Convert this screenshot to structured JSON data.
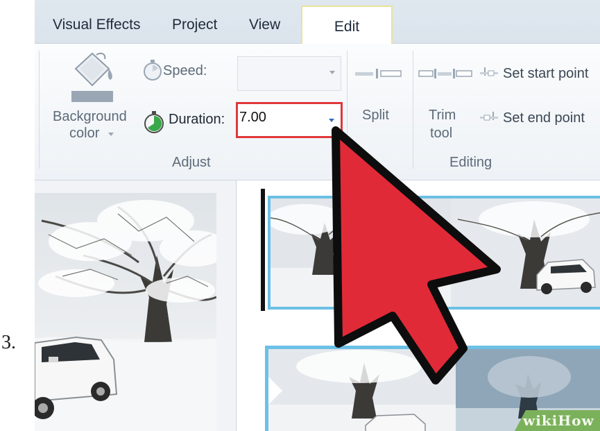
{
  "step": {
    "number": "3."
  },
  "tabs": [
    {
      "label": "Visual Effects"
    },
    {
      "label": "Project"
    },
    {
      "label": "View"
    },
    {
      "label": "Edit",
      "active": true
    }
  ],
  "ribbon": {
    "adjust": {
      "background_color_label_line1": "Background",
      "background_color_label_line2": "color",
      "speed_label": "Speed:",
      "speed_value": "",
      "duration_label": "Duration:",
      "duration_value": "7.00",
      "group_label": "Adjust"
    },
    "editing": {
      "split_label": "Split",
      "trim_label_line1": "Trim",
      "trim_label_line2": "tool",
      "set_start_label": "Set start point",
      "set_end_label": "Set end point",
      "group_label": "Editing"
    }
  },
  "watermark": {
    "text": "wikiHow"
  },
  "colors": {
    "highlight": "#e0373a",
    "cursor_fill": "#e12a38",
    "clip_border": "#6cc0e5",
    "tab_active_border": "#e9e39a",
    "watermark_bg": "#7bb15a"
  },
  "icons": [
    "paint-bucket-icon",
    "stopwatch-icon",
    "split-icon",
    "trim-tool-icon",
    "set-start-point-icon",
    "set-end-point-icon",
    "cursor-arrow-icon"
  ]
}
